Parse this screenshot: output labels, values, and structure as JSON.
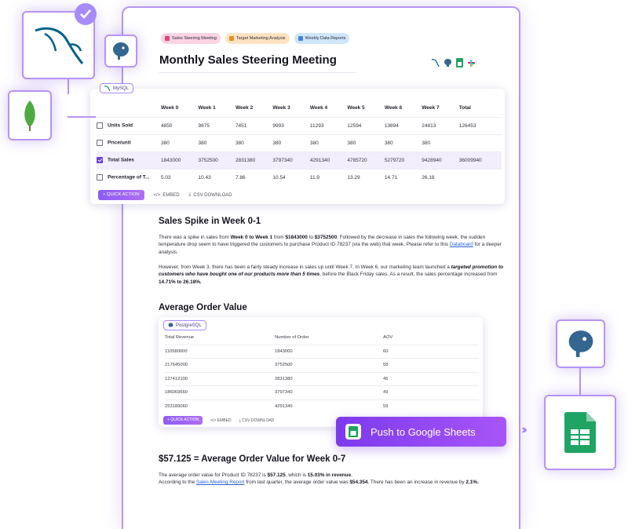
{
  "tags": [
    {
      "label": "Sales Steering Meeting"
    },
    {
      "label": "Target Marketing Analysis"
    },
    {
      "label": "Weekly Data Reports"
    }
  ],
  "doc_title": "Monthly Sales Steering Meeting",
  "sales_table": {
    "source": "MySQL",
    "headers": [
      "",
      "Week 0",
      "Week 1",
      "Week 2",
      "Week 3",
      "Week 4",
      "Week 5",
      "Week 6",
      "Week 7",
      "Total"
    ],
    "rows": [
      {
        "label": "Units Sold",
        "checked": false,
        "values": [
          "4850",
          "9875",
          "7451",
          "9993",
          "11293",
          "12594",
          "13894",
          "24813",
          "126453"
        ]
      },
      {
        "label": "Price/unit",
        "checked": false,
        "values": [
          "380",
          "380",
          "380",
          "380",
          "380",
          "380",
          "380",
          "380",
          ""
        ]
      },
      {
        "label": "Total Sales",
        "checked": true,
        "values": [
          "1843000",
          "3752500",
          "2831380",
          "3797340",
          "4291340",
          "4785720",
          "5279720",
          "9428940",
          "36009940"
        ]
      },
      {
        "label": "Percentage of T...",
        "checked": false,
        "values": [
          "5.03",
          "10.43",
          "7.86",
          "10.54",
          "11.9",
          "13.29",
          "14.71",
          "26.18",
          ""
        ]
      }
    ],
    "quick_action": "+ QUICK ACTION",
    "embed": "EMBED",
    "csv": "CSV DOWNLOAD"
  },
  "section1": {
    "heading": "Sales Spike in Week 0-1",
    "p1": {
      "a": "There was a spike in sales from ",
      "b": "Week 0 to Week 1",
      "c": " from ",
      "d": "$1843000",
      "e": " to ",
      "f": "$3752500",
      "g": ". Followed by the decrease in sales the following week, the sudden temperature drop seem to have triggered the customers to purchase Product ID 78237 (via the web) that week. Please refer to this ",
      "link": "Databoard",
      "h": " for a deeper analysis."
    },
    "p2": {
      "a": "However, from Week 3, there has been a fairly steady increase in sales up until Week 7. In Week 6, our marketing team launched a ",
      "hl": "targeted promotion to customers who have bought one of our products more than 5 times",
      "b": ", before the Black Friday sales. As a result, the sales percentage increased from ",
      "c": "14.71% to 26.18%."
    }
  },
  "section2": {
    "heading": "Average Order Value",
    "table": {
      "source": "PostgreSQL",
      "headers": [
        "Total Revenue",
        "Number of Order",
        "AOV"
      ],
      "rows": [
        [
          "110580000",
          "1843000",
          "60"
        ],
        [
          "217645000",
          "3752500",
          "58"
        ],
        [
          "127412100",
          "2831380",
          "45"
        ],
        [
          "186069660",
          "3797340",
          "49"
        ],
        [
          "253189060",
          "4291340",
          "59"
        ]
      ],
      "quick_action": "+ QUICK ACTION",
      "embed": "EMBED",
      "csv": "CSV DOWNLOAD"
    }
  },
  "section3": {
    "heading": "$57.125 = Average Order Value for Week 0-7",
    "p": {
      "a": "The average order value for Product ID 78237 is ",
      "b": "$57.125",
      "c": ", which is ",
      "d": "15.03% in revenue",
      "e": ".",
      "f": "According to the ",
      "link": "Sales Meeting Report",
      "g": " from last quarter, the average order value was ",
      "h": "$54.354",
      "i": ". There has been an increase in revenue by ",
      "j": "2.1%."
    }
  },
  "push_button": "Push to Google Sheets",
  "colors": {
    "accent": "#8b5cf6",
    "border": "#b794f4",
    "sheets_green": "#1fa463",
    "mongo_green": "#4faa41",
    "mysql_blue": "#00618a"
  }
}
